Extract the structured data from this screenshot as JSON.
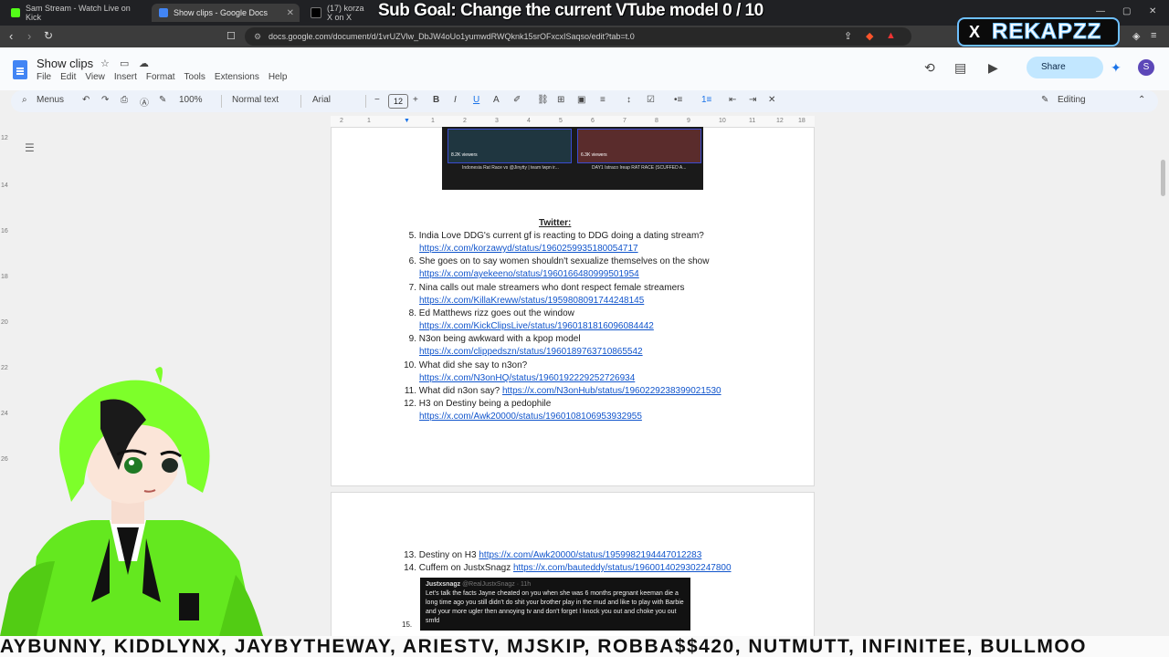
{
  "browser": {
    "tabs": [
      {
        "title": "Sam Stream - Watch Live on Kick",
        "active": false
      },
      {
        "title": "Show clips - Google Docs",
        "active": true
      },
      {
        "title": "(17) korza X on X",
        "active": false
      }
    ],
    "url": "docs.google.com/document/d/1vrUZVlw_DbJW4oUo1yumwdRWQknk15srOFxcxISaqso/edit?tab=t.0"
  },
  "overlay": {
    "subgoal": "Sub Goal: Change the current VTube model  0 / 10",
    "brand_name": "REKAPZZ",
    "ticker": "AYBUNNY, KIDDLYNX, JAYBYTHEWAY, ARIESTV, MJSKIP, ROBBA$$420, NUTMUTT, INFINITEE, BULLMOO"
  },
  "docs": {
    "title": "Show clips",
    "menu": [
      "File",
      "Edit",
      "View",
      "Insert",
      "Format",
      "Tools",
      "Extensions",
      "Help"
    ],
    "share_label": "Share",
    "avatar_letter": "S",
    "toolbar": {
      "search": "Menus",
      "zoom": "100%",
      "style": "Normal text",
      "font": "Arial",
      "font_size": "12",
      "mode": "Editing"
    },
    "twitter_heading": "Twitter:",
    "items": [
      {
        "num": "5.",
        "text": "India Love DDG's current gf is reacting to DDG doing a dating stream?",
        "link": "https://x.com/korzawyd/status/1960259935180054717"
      },
      {
        "num": "6.",
        "text": "She goes on to say women shouldn't sexualize themselves on the show",
        "link": "https://x.com/ayekeeno/status/1960166480999501954"
      },
      {
        "num": "7.",
        "text": "Nina calls out male streamers who dont respect female streamers",
        "link": "https://x.com/KillaKreww/status/1959808091744248145"
      },
      {
        "num": "8.",
        "text": "Ed Matthews rizz goes out the window",
        "link": "https://x.com/KickClipsLive/status/1960181816096084442"
      },
      {
        "num": "9.",
        "text": "N3on being awkward with a kpop model",
        "link": "https://x.com/clippedszn/status/1960189763710865542"
      },
      {
        "num": "10.",
        "text": "What did she say to n3on?",
        "link": "https://x.com/N3onHQ/status/1960192229252726934"
      },
      {
        "num": "11.",
        "text": "What did n3on say?",
        "link": "https://x.com/N3onHub/status/1960229238399021530"
      },
      {
        "num": "12.",
        "text": "H3 on Destiny being a pedophile",
        "link": "https://x.com/Awk20000/status/1960108106953932955"
      }
    ],
    "page2_items": [
      {
        "num": "13.",
        "text": "Destiny on H3",
        "link": "https://x.com/Awk20000/status/1959982194447012283"
      },
      {
        "num": "14.",
        "text": "Cuffem on JustxSnagz",
        "link": "https://x.com/bauteddy/status/1960014029302247800"
      }
    ],
    "page2_next_num": "15.",
    "embed": {
      "left_viewers": "8.2K viewers",
      "right_viewers": "6.3K viewers",
      "left_title": "Indonesia Rat Race vs @Jinytty | team lwpn ir...",
      "right_title": "DAY1 Istraco Ireap RAT RACE (SCUFFED A..."
    },
    "tweet": {
      "user": "Justxsnagz",
      "handle": "@RealJustxSnagz · 11h",
      "text": "Let's talk the facts Jayne cheated on you when she was 6 months pregnant keeman die a long time ago you still didn't do shit your brother play in the mud and like to play with Barbie and your more ugler then annoying tv and don't forget I knock you out and choke you out smfd"
    }
  },
  "colors": {
    "link": "#1155cc",
    "vtuber_hair": "#7dff2a",
    "share_bg": "#c2e7ff"
  }
}
